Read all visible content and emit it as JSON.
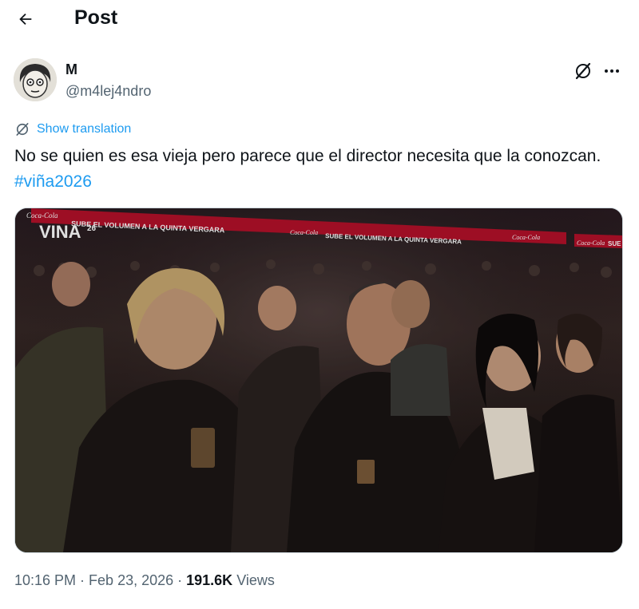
{
  "header": {
    "title": "Post"
  },
  "author": {
    "display_name": "M",
    "handle": "@m4lej4ndro"
  },
  "post": {
    "translate_label": "Show translation",
    "text_main": "No se quien es esa vieja pero parece que el director necesita que la conozcan. ",
    "hashtag": "#viña2026",
    "media": {
      "banner_text_1": "SUBE EL VOLUMEN A LA QUINTA VERGARA",
      "banner_text_2": "SUBE EL VOLUMEN A LA QUINTA VERGARA",
      "banner_brand": "Coca-Cola",
      "banner_text_3": "SUE",
      "logo": "VINA",
      "logo_suffix": "26"
    }
  },
  "meta": {
    "time": "10:16 PM",
    "sep1": " · ",
    "date": "Feb 23, 2026",
    "sep2": " · ",
    "views_count": "191.6K",
    "views_label": " Views"
  },
  "colors": {
    "accent": "#1d9bf0",
    "secondary_text": "#536471",
    "banner_red": "#c8102e"
  },
  "icons": [
    "back-arrow-icon",
    "grok-icon",
    "more-icon",
    "translate-icon"
  ]
}
